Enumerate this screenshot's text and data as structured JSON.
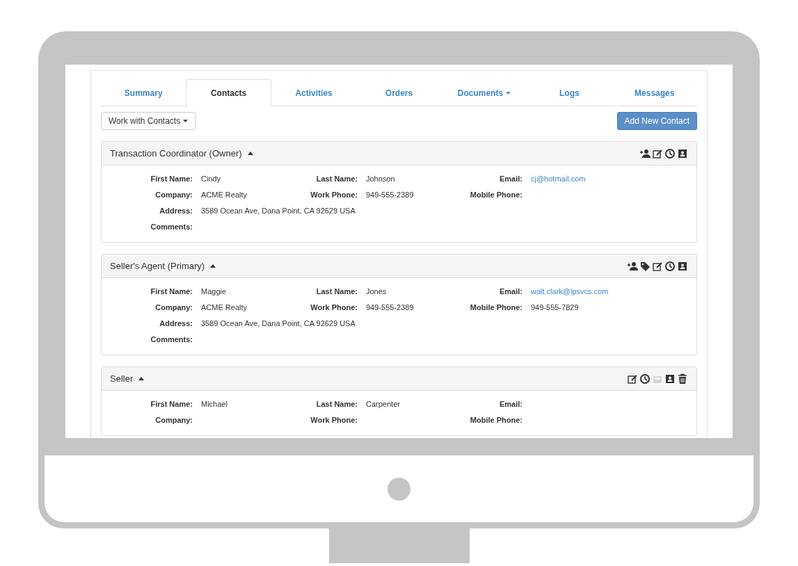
{
  "tabs": [
    {
      "label": "Summary",
      "selected": false,
      "dropdown": false
    },
    {
      "label": "Contacts",
      "selected": true,
      "dropdown": false
    },
    {
      "label": "Activities",
      "selected": false,
      "dropdown": false
    },
    {
      "label": "Orders",
      "selected": false,
      "dropdown": false
    },
    {
      "label": "Documents",
      "selected": false,
      "dropdown": true
    },
    {
      "label": "Logs",
      "selected": false,
      "dropdown": false
    },
    {
      "label": "Messages",
      "selected": false,
      "dropdown": false
    }
  ],
  "toolbar": {
    "menu_button": "Work with Contacts",
    "add_button": "Add New Contact"
  },
  "contacts": [
    {
      "title": "Transaction Coordinator (Owner)",
      "expanded": true,
      "icons": [
        {
          "kind": "add-person",
          "disabled": false
        },
        {
          "kind": "edit",
          "disabled": false
        },
        {
          "kind": "clock",
          "disabled": false
        },
        {
          "kind": "contact-card",
          "disabled": false
        }
      ],
      "rows": [
        [
          {
            "label": "First Name:",
            "value": "Cindy"
          },
          {
            "label": "Last Name:",
            "value": "Johnson"
          },
          {
            "label": "Email:",
            "value": "cj@hotmail.com",
            "kind": "link"
          }
        ],
        [
          {
            "label": "Company:",
            "value": "ACME Realty"
          },
          {
            "label": "Work Phone:",
            "value": "949-555-2389"
          },
          {
            "label": "Mobile Phone:"
          }
        ],
        [
          {
            "label": "Address:",
            "value": "3589 Ocean Ave, Dana Point, CA 92629 USA"
          }
        ],
        [
          {
            "label": "Comments:"
          }
        ]
      ]
    },
    {
      "title": "Seller's Agent (Primary)",
      "expanded": true,
      "icons": [
        {
          "kind": "add-person",
          "disabled": false
        },
        {
          "kind": "tag",
          "disabled": false
        },
        {
          "kind": "edit",
          "disabled": false
        },
        {
          "kind": "clock",
          "disabled": false
        },
        {
          "kind": "contact-card",
          "disabled": false
        }
      ],
      "rows": [
        [
          {
            "label": "First Name:",
            "value": "Maggie"
          },
          {
            "label": "Last Name:",
            "value": "Jones"
          },
          {
            "label": "Email:",
            "value": "walt.clark@lpsvcs.com",
            "kind": "link"
          }
        ],
        [
          {
            "label": "Company:",
            "value": "ACME Realty"
          },
          {
            "label": "Work Phone:",
            "value": "949-555-2389"
          },
          {
            "label": "Mobile Phone:",
            "value": "949-555-7829"
          }
        ],
        [
          {
            "label": "Address:",
            "value": "3589 Ocean Ave, Dana Point, CA 92629 USA"
          }
        ],
        [
          {
            "label": "Comments:"
          }
        ]
      ]
    },
    {
      "title": "Seller",
      "expanded": true,
      "icons": [
        {
          "kind": "edit",
          "disabled": false
        },
        {
          "kind": "clock",
          "disabled": false
        },
        {
          "kind": "inbox",
          "disabled": true
        },
        {
          "kind": "contact-card",
          "disabled": false
        },
        {
          "kind": "trash",
          "disabled": false
        }
      ],
      "rows": [
        [
          {
            "label": "First Name:",
            "value": "Michael"
          },
          {
            "label": "Last Name:",
            "value": "Carpenter"
          },
          {
            "label": "Email:"
          }
        ],
        [
          {
            "label": "Company:"
          },
          {
            "label": "Work Phone:"
          },
          {
            "label": "Mobile Phone:"
          }
        ]
      ]
    }
  ]
}
